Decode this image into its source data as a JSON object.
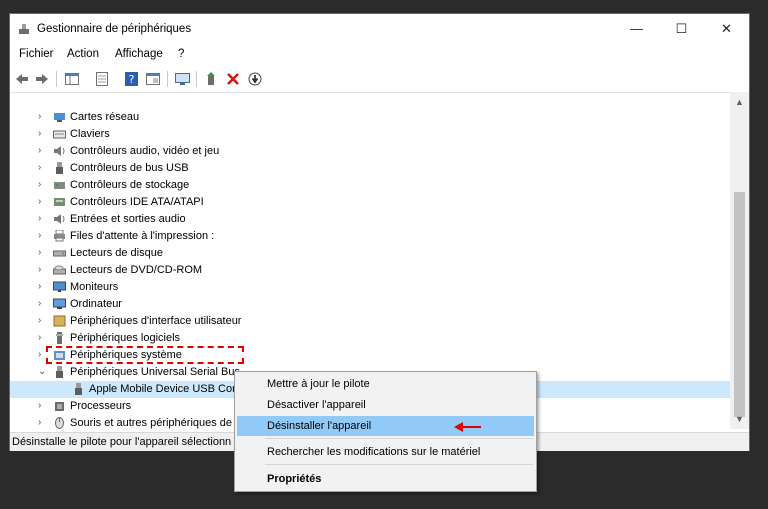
{
  "window": {
    "title": "Gestionnaire de périphériques",
    "minimize": "—",
    "maximize": "☐",
    "close": "✕"
  },
  "menu": [
    "Fichier",
    "Action",
    "Affichage",
    "?"
  ],
  "tree": [
    {
      "label": "Cartes réseau",
      "icon": "network-adapter-icon",
      "expanded": false
    },
    {
      "label": "Claviers",
      "icon": "keyboard-icon",
      "expanded": false
    },
    {
      "label": "Contrôleurs audio, vidéo et jeu",
      "icon": "speaker-icon",
      "expanded": false
    },
    {
      "label": "Contrôleurs de bus USB",
      "icon": "usb-icon",
      "expanded": false
    },
    {
      "label": "Contrôleurs de stockage",
      "icon": "storage-controller-icon",
      "expanded": false
    },
    {
      "label": "Contrôleurs IDE ATA/ATAPI",
      "icon": "ide-controller-icon",
      "expanded": false
    },
    {
      "label": "Entrées et sorties audio",
      "icon": "speaker-icon",
      "expanded": false
    },
    {
      "label": "Files d'attente à l'impression :",
      "icon": "printer-icon",
      "expanded": false
    },
    {
      "label": "Lecteurs de disque",
      "icon": "disk-drive-icon",
      "expanded": false
    },
    {
      "label": "Lecteurs de DVD/CD-ROM",
      "icon": "dvd-icon",
      "expanded": false
    },
    {
      "label": "Moniteurs",
      "icon": "monitor-icon",
      "expanded": false
    },
    {
      "label": "Ordinateur",
      "icon": "computer-icon",
      "expanded": false
    },
    {
      "label": "Périphériques d'interface utilisateur",
      "icon": "hid-icon",
      "expanded": false
    },
    {
      "label": "Périphériques logiciels",
      "icon": "software-device-icon",
      "expanded": false
    },
    {
      "label": "Périphériques système",
      "icon": "system-device-icon",
      "expanded": false
    },
    {
      "label": "Périphériques Universal Serial Bus",
      "icon": "usb-icon",
      "expanded": true
    },
    {
      "label": "Apple Mobile Device USB Cor",
      "icon": "usb-icon",
      "child": true
    },
    {
      "label": "Processeurs",
      "icon": "processor-icon",
      "expanded": false
    },
    {
      "label": "Souris et autres périphériques de",
      "icon": "mouse-icon",
      "expanded": false
    }
  ],
  "context_menu": {
    "update_driver": "Mettre à jour le pilote",
    "disable_device": "Désactiver l'appareil",
    "uninstall_device": "Désinstaller l'appareil",
    "scan_changes": "Rechercher les modifications sur le matériel",
    "properties": "Propriétés"
  },
  "status": "Désinstalle le pilote pour l'appareil sélectionn",
  "colors": {
    "highlight": "#91c9f7",
    "annotation": "#e00000"
  }
}
